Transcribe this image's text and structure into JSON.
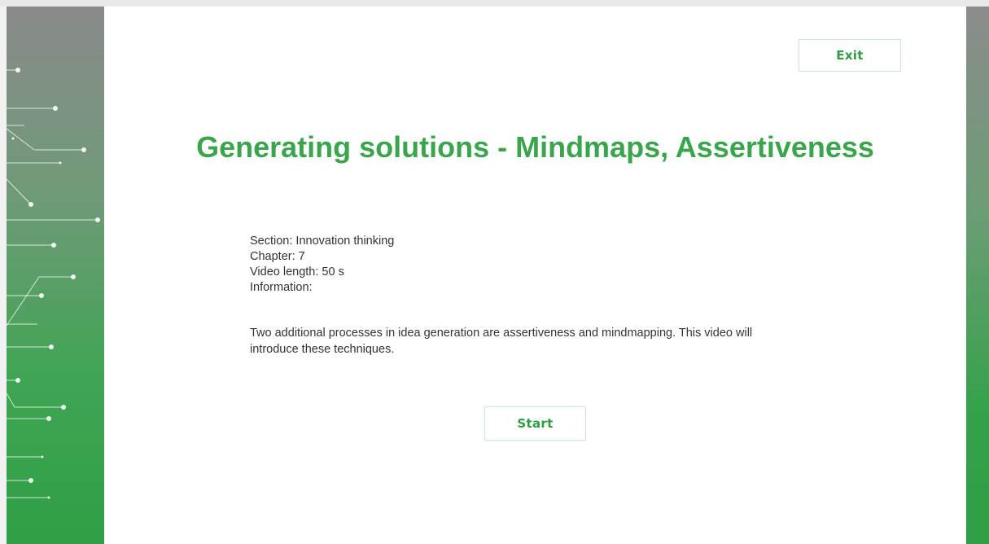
{
  "header": {
    "exit_label": "Exit"
  },
  "main": {
    "title": "Generating solutions - Mindmaps, Assertiveness",
    "details": [
      "Section: Innovation thinking",
      "Chapter: 7",
      "Video length: 50 s",
      "Information:"
    ],
    "description": "Two additional processes in idea generation are assertiveness and mindmapping. This video will introduce these techniques.",
    "start_label": "Start"
  },
  "theme": {
    "accent": "#3aa54c",
    "button_text": "#2e9c41",
    "body_text": "#333333",
    "panel_top": "#8a8a8a",
    "panel_bottom": "#2f9f46"
  },
  "decoration": {
    "left_panel": "circuit-pattern-icon"
  }
}
